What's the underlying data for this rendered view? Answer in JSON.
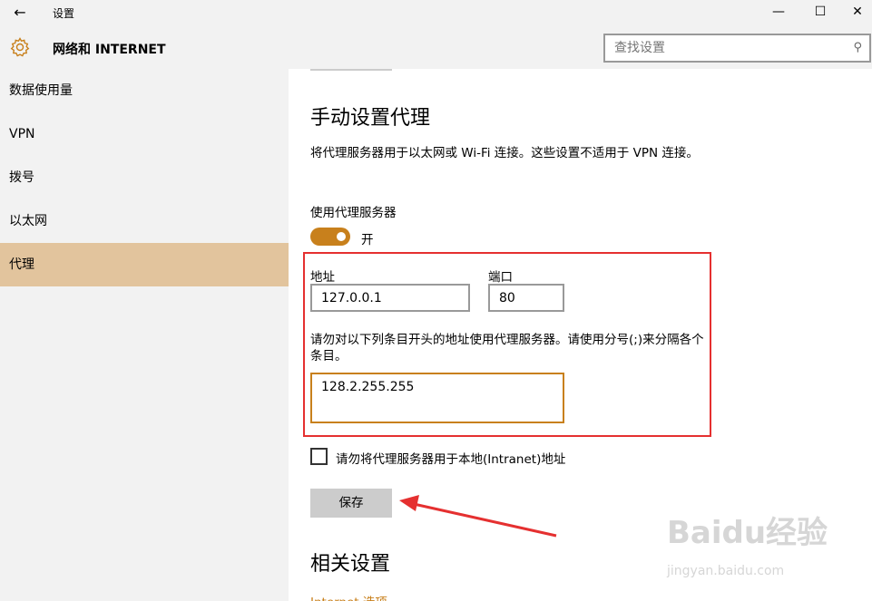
{
  "window": {
    "back_glyph": "←",
    "title": "设置",
    "minimize_glyph": "—",
    "maximize_glyph": "☐",
    "close_glyph": "✕"
  },
  "header": {
    "icon": "gear-icon",
    "section_title": "网络和 INTERNET",
    "search_placeholder": "查找设置",
    "search_icon_glyph": "⚲"
  },
  "sidebar": {
    "items": [
      {
        "label": "数据使用量"
      },
      {
        "label": "VPN"
      },
      {
        "label": "拨号"
      },
      {
        "label": "以太网"
      },
      {
        "label": "代理",
        "active": true
      }
    ]
  },
  "main": {
    "manual_title": "手动设置代理",
    "description": "将代理服务器用于以太网或 Wi-Fi 连接。这些设置不适用于 VPN 连接。",
    "use_proxy_label": "使用代理服务器",
    "toggle_state": "开",
    "address_label": "地址",
    "address_value": "127.0.0.1",
    "port_label": "端口",
    "port_value": "80",
    "exceptions_description": "请勿对以下列条目开头的地址使用代理服务器。请使用分号(;)来分隔各个条目。",
    "exceptions_value": "128.2.255.255",
    "bypass_local_label": "请勿将代理服务器用于本地(Intranet)地址",
    "bypass_local_checked": false,
    "save_label": "保存",
    "related_title": "相关设置",
    "internet_options_link": "Internet 选项"
  },
  "watermark": {
    "logo": "Baidu经验",
    "url": "jingyan.baidu.com"
  },
  "colors": {
    "accent": "#c8801c",
    "sidebar_active": "#e2c49d",
    "annotation_red": "#e53030",
    "chrome_bg": "#f2f2f2"
  }
}
